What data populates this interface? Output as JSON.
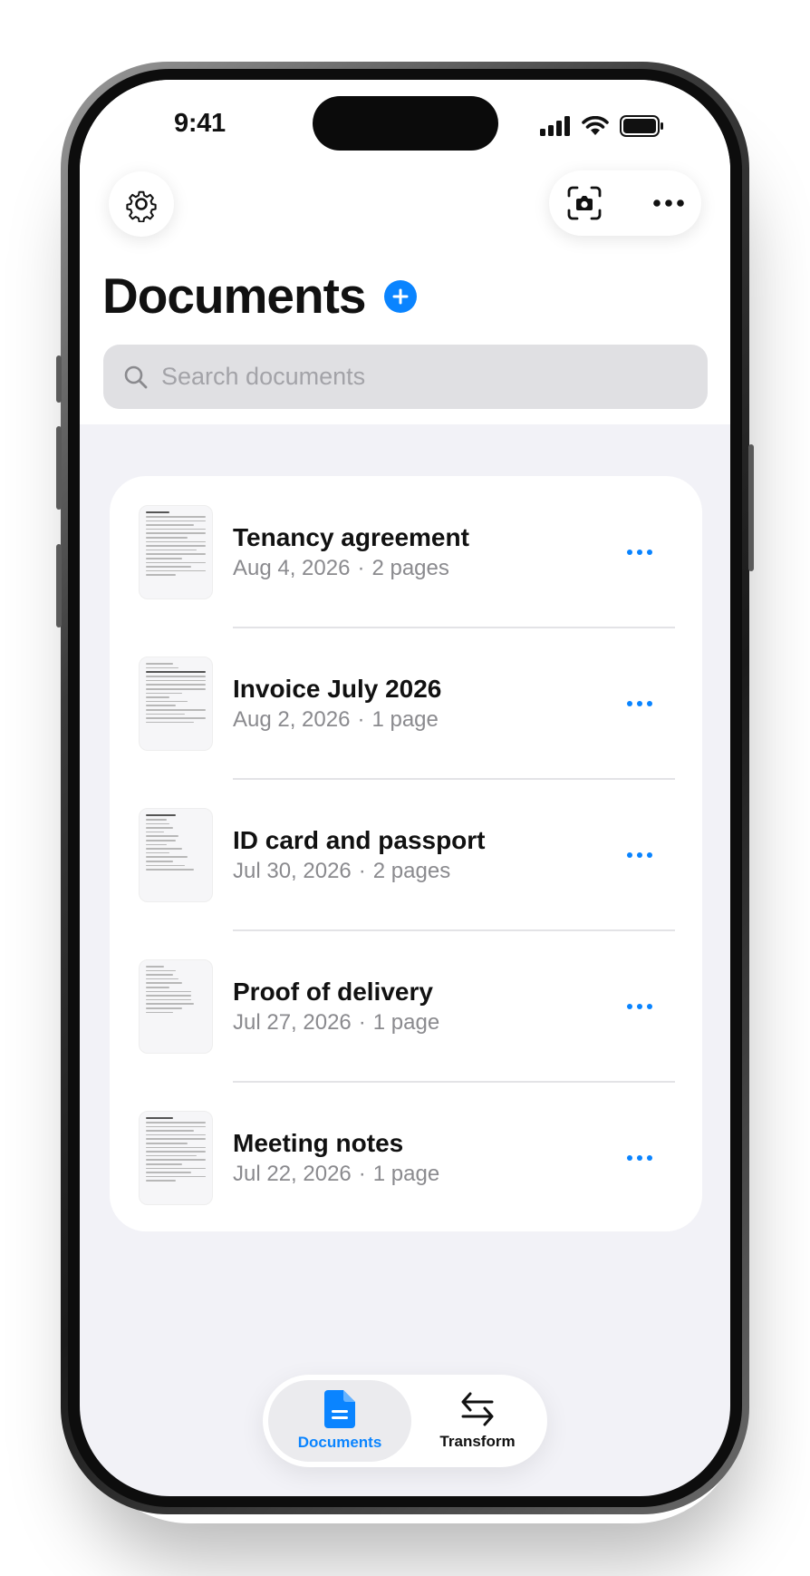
{
  "status_bar": {
    "time": "9:41"
  },
  "toolbar": {
    "settings_icon": "gear-icon",
    "scan_icon": "camera-scan-icon",
    "more_icon": "ellipsis-icon"
  },
  "header": {
    "title": "Documents",
    "add_icon": "plus-circle-icon"
  },
  "search": {
    "placeholder": "Search documents",
    "icon": "search-icon"
  },
  "documents": [
    {
      "title": "Tenancy agreement",
      "date": "Aug 4, 2026",
      "pages": "2 pages"
    },
    {
      "title": "Invoice July 2026",
      "date": "Aug 2, 2026",
      "pages": "1 page"
    },
    {
      "title": "ID card and passport",
      "date": "Jul 30, 2026",
      "pages": "2 pages"
    },
    {
      "title": "Proof of delivery",
      "date": "Jul 27, 2026",
      "pages": "1 page"
    },
    {
      "title": "Meeting notes",
      "date": "Jul 22, 2026",
      "pages": "1 page"
    }
  ],
  "meta_separator": "·",
  "tab_bar": {
    "tabs": [
      {
        "label": "Documents",
        "icon": "document-icon",
        "selected": true
      },
      {
        "label": "Transform",
        "icon": "arrows-left-right-icon",
        "selected": false
      }
    ]
  },
  "colors": {
    "accent": "#0a84ff",
    "background": "#f2f2f7",
    "card": "#ffffff",
    "secondary_text": "#8a8a8e"
  }
}
